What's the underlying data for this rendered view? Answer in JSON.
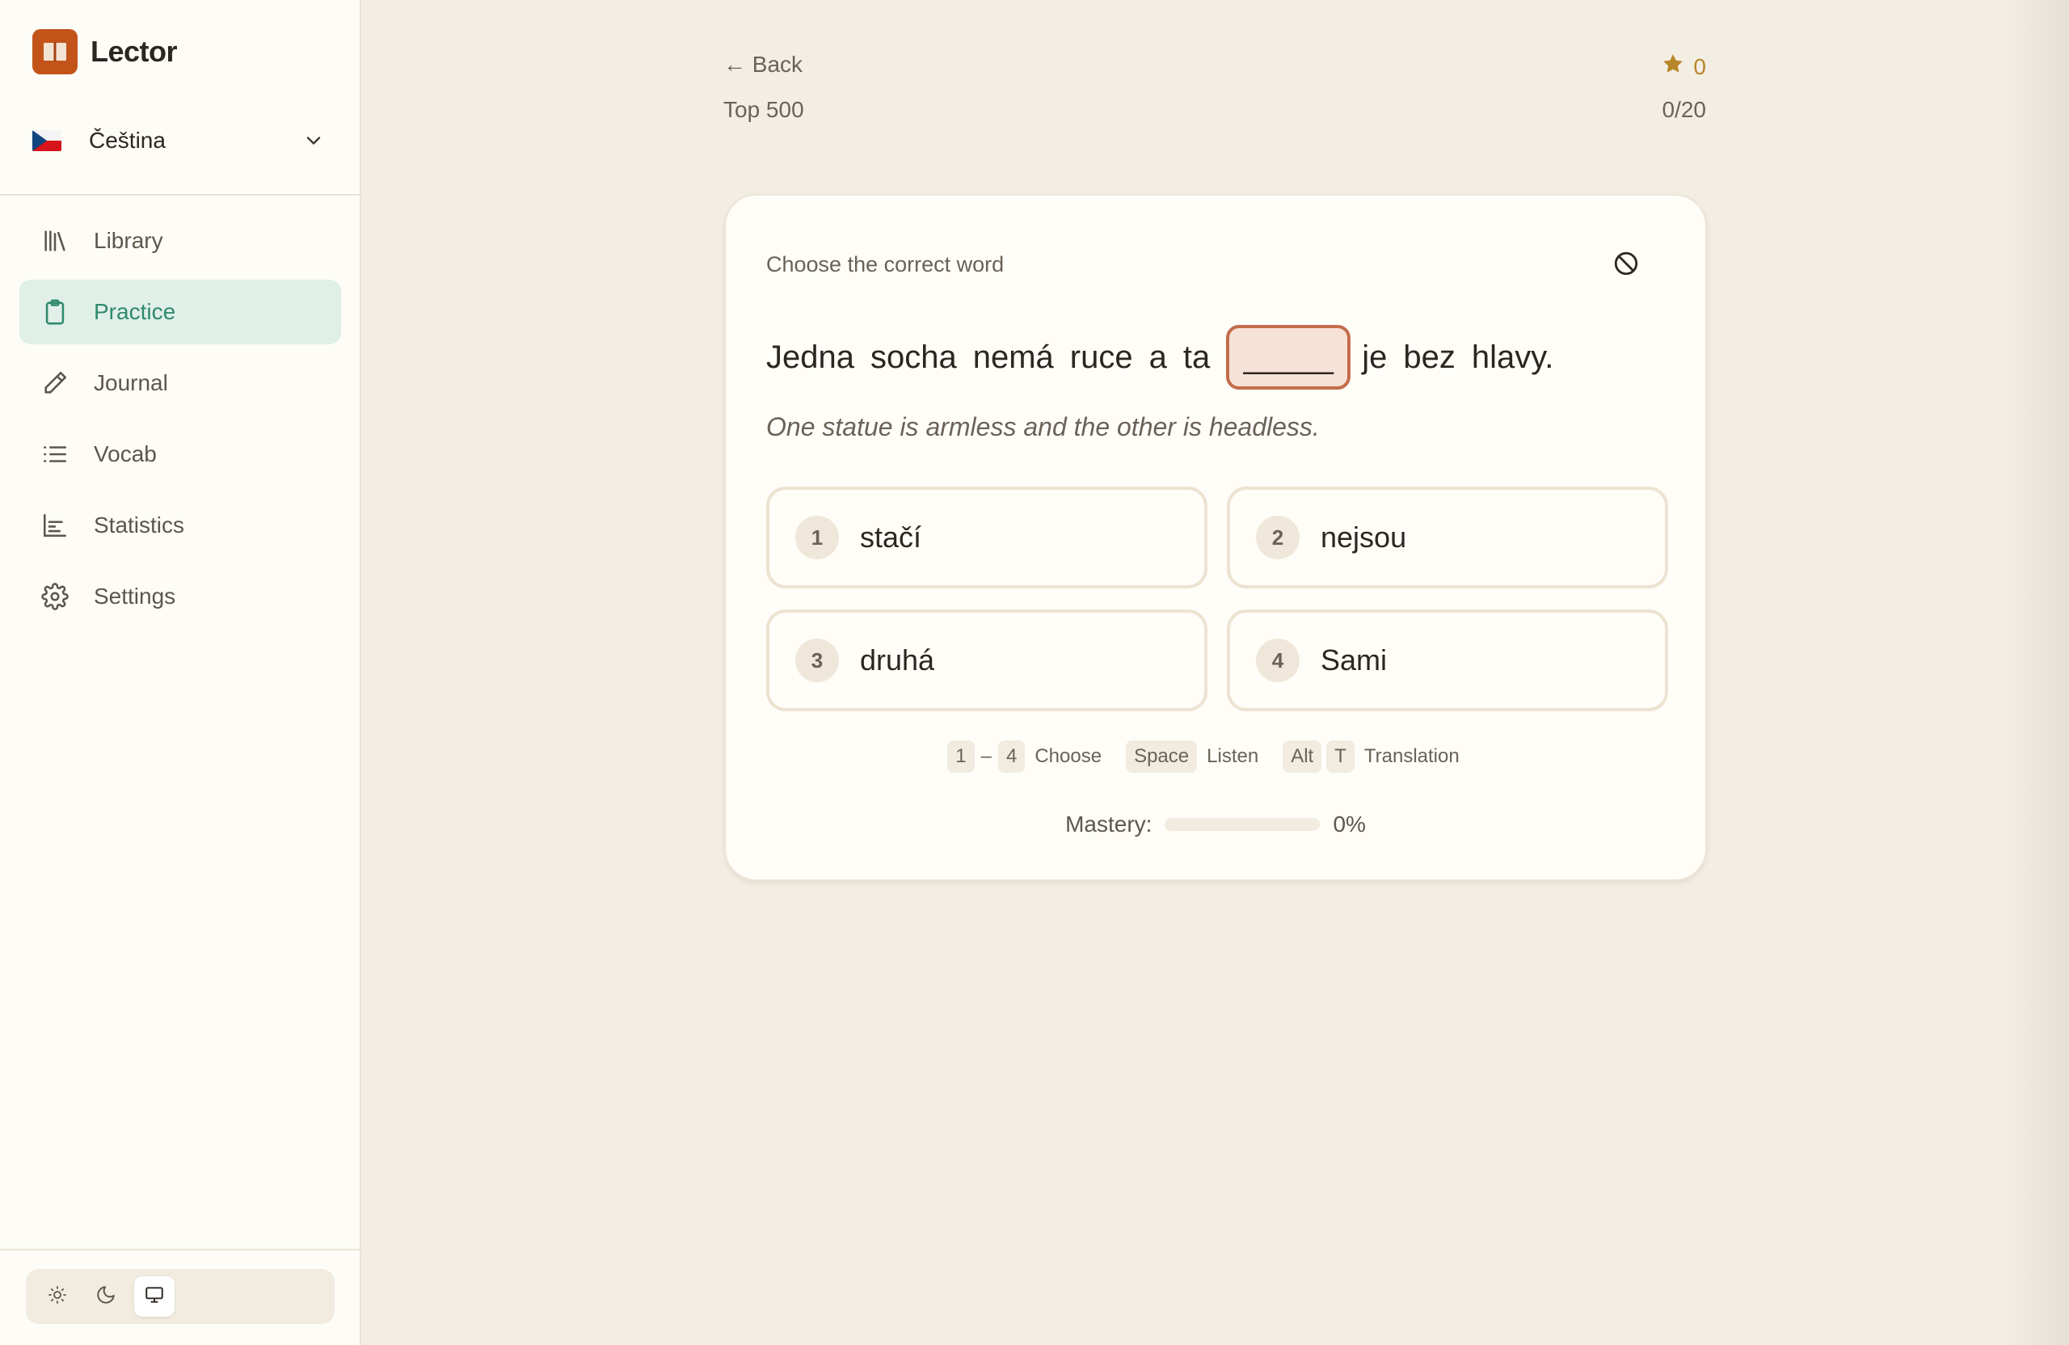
{
  "app": {
    "name": "Lector"
  },
  "language": {
    "label": "Čeština"
  },
  "sidebar": {
    "items": [
      {
        "label": "Library",
        "icon": "library-icon"
      },
      {
        "label": "Practice",
        "icon": "clipboard-icon",
        "active": true
      },
      {
        "label": "Journal",
        "icon": "pencil-icon"
      },
      {
        "label": "Vocab",
        "icon": "list-icon"
      },
      {
        "label": "Statistics",
        "icon": "bar-chart-icon"
      },
      {
        "label": "Settings",
        "icon": "gear-icon"
      }
    ],
    "theme": {
      "options": [
        "light",
        "dark",
        "system"
      ],
      "selected": "system"
    }
  },
  "header": {
    "back_label": "← Back",
    "deck_title": "Top 500",
    "score": "0",
    "progress": "0/20"
  },
  "card": {
    "prompt": "Choose the correct word",
    "sentence_before": [
      "Jedna",
      "socha",
      "nemá",
      "ruce",
      "a",
      "ta"
    ],
    "blank": "_____",
    "sentence_after": [
      "je",
      "bez",
      "hlavy."
    ],
    "translation": "One statue is armless and the other is headless.",
    "options": [
      {
        "num": "1",
        "text": "stačí"
      },
      {
        "num": "2",
        "text": "nejsou"
      },
      {
        "num": "3",
        "text": "druhá"
      },
      {
        "num": "4",
        "text": "Sami"
      }
    ],
    "shortcuts": {
      "range_start": "1",
      "range_sep": "–",
      "range_end": "4",
      "choose_label": "Choose",
      "space_key": "Space",
      "listen_label": "Listen",
      "alt_key": "Alt",
      "t_key": "T",
      "translation_label": "Translation"
    },
    "mastery": {
      "label": "Mastery:",
      "percent_text": "0%",
      "value": 0
    }
  },
  "colors": {
    "accent": "#2f8a6b",
    "brand": "#c2541a",
    "blank_border": "#c46d4b",
    "star": "#b8862a"
  }
}
